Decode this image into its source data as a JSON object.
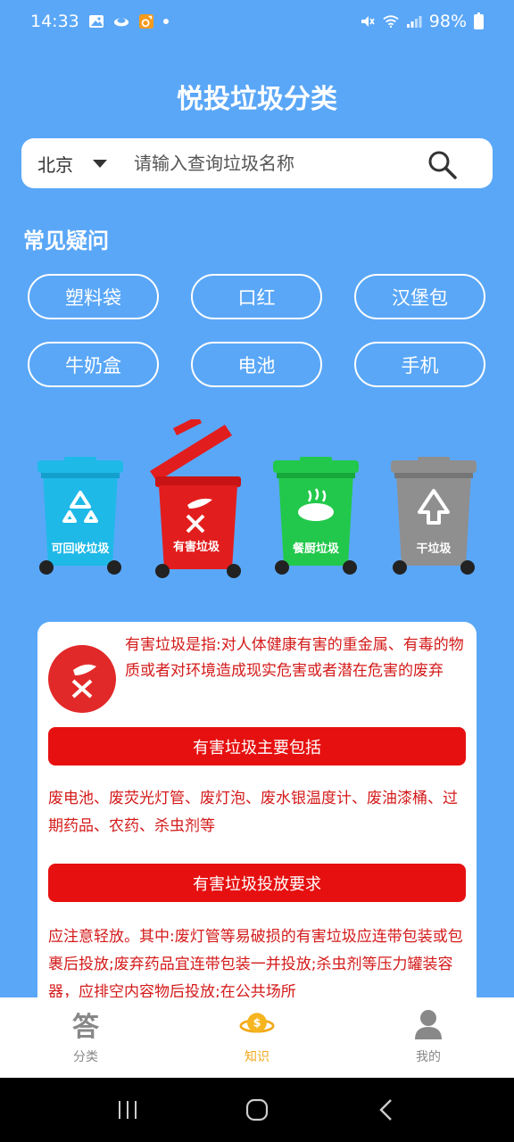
{
  "status": {
    "time": "14:33",
    "battery": "98%",
    "left_icons": [
      "gallery-icon",
      "cloud-icon",
      "app-notify-icon",
      "dot-icon"
    ],
    "right_icons": [
      "mute-icon",
      "wifi-icon",
      "signal-icon",
      "battery-icon"
    ]
  },
  "header": {
    "title": "悦投垃圾分类"
  },
  "search": {
    "city": "北京",
    "placeholder": "请输入查询垃圾名称"
  },
  "faq": {
    "title": "常见疑问",
    "items": [
      "塑料袋",
      "口红",
      "汉堡包",
      "牛奶盒",
      "电池",
      "手机"
    ]
  },
  "bins": [
    {
      "label": "可回收垃圾",
      "color": "#1fb9e8",
      "selected": false
    },
    {
      "label": "有害垃圾",
      "color": "#e21d1d",
      "selected": true
    },
    {
      "label": "餐厨垃圾",
      "color": "#22c84b",
      "selected": false
    },
    {
      "label": "干垃圾",
      "color": "#8f8f8f",
      "selected": false
    }
  ],
  "info": {
    "description": "有害垃圾是指:对人体健康有害的重金属、有毒的物质或者对环境造成现实危害或者潜在危害的废弃",
    "section1_title": "有害垃圾主要包括",
    "section1_text": "废电池、废荧光灯管、废灯泡、废水银温度计、废油漆桶、过期药品、农药、杀虫剂等",
    "section2_title": "有害垃圾投放要求",
    "section2_text": "应注意轻放。其中:废灯管等易破损的有害垃圾应连带包装或包裹后投放;废弃药品宜连带包装一并投放;杀虫剂等压力罐装容器，应排空内容物后投放;在公共场所"
  },
  "tabs": [
    {
      "label": "分类",
      "icon_text": "答",
      "active": false
    },
    {
      "label": "知识",
      "active": true
    },
    {
      "label": "我的",
      "active": false
    }
  ],
  "colors": {
    "background": "#5aa7f7",
    "accent_red": "#e61010",
    "active_tab": "#f2a91a",
    "inactive_tab": "#888888"
  }
}
